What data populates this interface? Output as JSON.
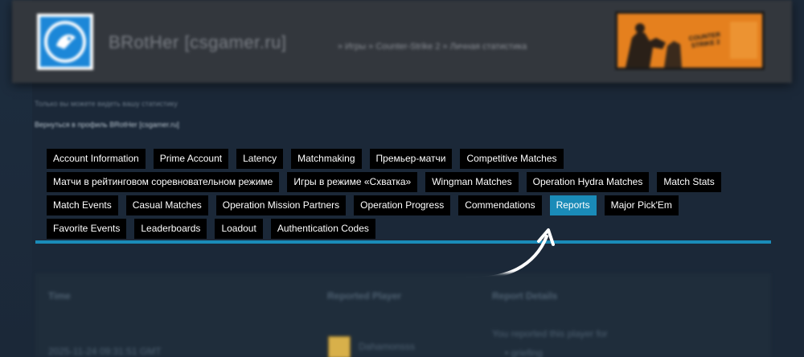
{
  "profile": {
    "persona_name": "BRotHer [csgamer.ru]",
    "breadcrumb": "» Игры » Counter-Strike 2 » Личная статистика",
    "game_logo_text": "COUNTER STRIKE 2"
  },
  "notes": {
    "privacy_note": "Только вы можете видеть вашу статистику",
    "back_link": "Вернуться в профиль BRotHer [csgamer.ru]"
  },
  "tabs": [
    {
      "label": "Account Information"
    },
    {
      "label": "Prime Account"
    },
    {
      "label": "Latency"
    },
    {
      "label": "Matchmaking"
    },
    {
      "label": "Премьер-матчи"
    },
    {
      "label": "Competitive Matches"
    },
    {
      "label": "Матчи в рейтинговом соревновательном режиме"
    },
    {
      "label": "Игры в режиме «Схватка»"
    },
    {
      "label": "Wingman Matches"
    },
    {
      "label": "Operation Hydra Matches"
    },
    {
      "label": "Match Stats"
    },
    {
      "label": "Match Events"
    },
    {
      "label": "Casual Matches"
    },
    {
      "label": "Operation Mission Partners"
    },
    {
      "label": "Operation Progress"
    },
    {
      "label": "Commendations"
    },
    {
      "label": "Reports"
    },
    {
      "label": "Major Pick'Em"
    },
    {
      "label": "Favorite Events"
    },
    {
      "label": "Leaderboards"
    },
    {
      "label": "Loadout"
    },
    {
      "label": "Authentication Codes"
    }
  ],
  "active_tab": "Reports",
  "report_table": {
    "headers": {
      "time": "Time",
      "reported_player": "Reported Player",
      "report_details": "Report Details"
    },
    "rows": [
      {
        "time": "2025-11-24 09:31:51 GMT",
        "player": "Dahamonsss",
        "details": "You reported this player for",
        "detail_item": "• griefing"
      }
    ]
  },
  "colors": {
    "accent": "#1a8bb8",
    "page_bg": "#1b2838",
    "header_bg": "#33373d",
    "tab_bg": "#000000",
    "banner_orange": "#e5801e"
  }
}
